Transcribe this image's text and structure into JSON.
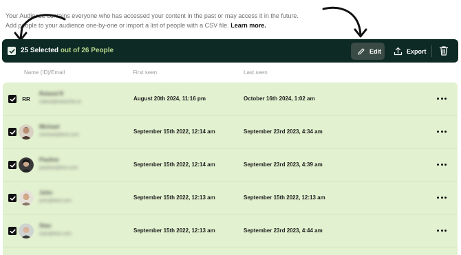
{
  "intro": {
    "line1": "Your Audience contains everyone who has accessed your content in the past or may access it in the future.",
    "line2": "Add people to your audience one-by-one or import a list of people with a CSV file.",
    "learn_more": "Learn more."
  },
  "toolbar": {
    "selected_count": "25 Selected",
    "of_total": "out of 26 People",
    "edit_label": "Edit",
    "export_label": "Export",
    "bg_color": "#0d2a24",
    "accent_color": "#b9d98f"
  },
  "columns": {
    "name": "Name (ID)/Email",
    "first_seen": "First seen",
    "last_seen": "Last seen"
  },
  "rows": [
    {
      "initials": "RR",
      "name": "Roland R",
      "email": "roland@searchto.io",
      "first_seen": "August 20th 2024, 11:16 pm",
      "last_seen": "October 16th 2024, 1:02 am",
      "avatar_color": "#e2f1cf"
    },
    {
      "initials": "",
      "name": "Michael",
      "email": "michael@test.com",
      "first_seen": "September 15th 2022, 12:14 am",
      "last_seen": "September 23rd 2023, 4:34 am",
      "avatar_color": "#4a3a30"
    },
    {
      "initials": "",
      "name": "Pauline",
      "email": "pauline@test.com",
      "first_seen": "September 15th 2022, 12:14 am",
      "last_seen": "September 23rd 2023, 4:39 am",
      "avatar_color": "#2a2a2a"
    },
    {
      "initials": "",
      "name": "John",
      "email": "john@test.com",
      "first_seen": "September 15th 2022, 12:13 am",
      "last_seen": "September 15th 2022, 12:13 am",
      "avatar_color": "#8a7868"
    },
    {
      "initials": "",
      "name": "Stan",
      "email": "stan@test.com",
      "first_seen": "September 15th 2022, 12:13 am",
      "last_seen": "September 23rd 2023, 4:44 am",
      "avatar_color": "#7c8480"
    }
  ],
  "colors": {
    "row_selected_bg": "#e2f1cf"
  }
}
